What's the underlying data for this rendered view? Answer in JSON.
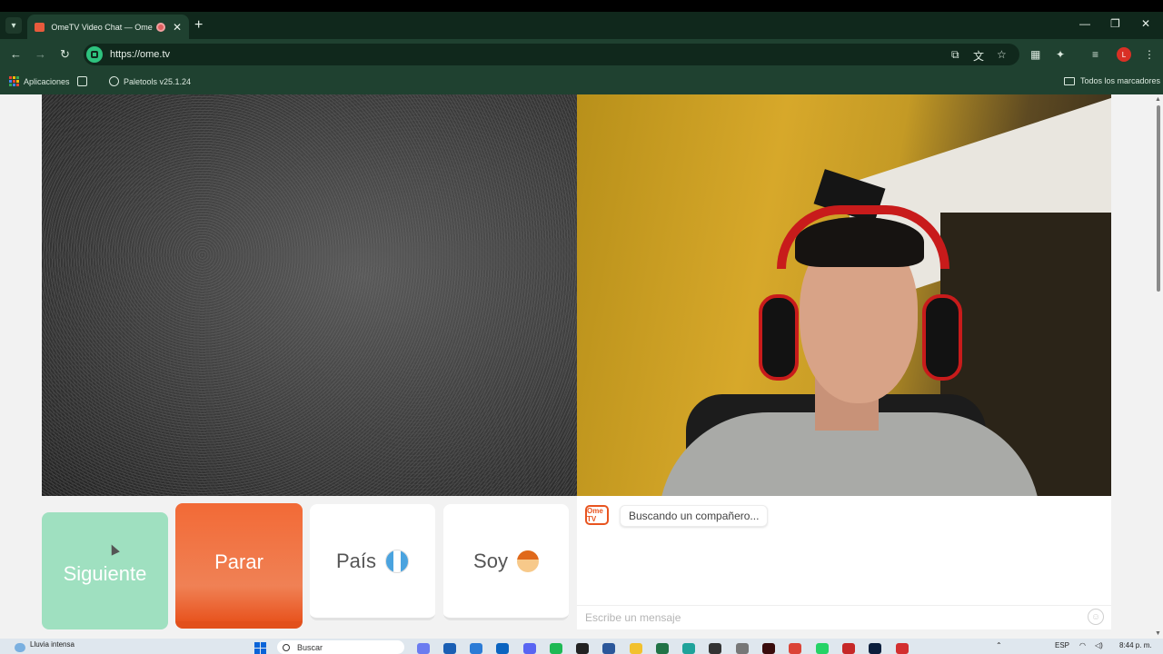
{
  "browser": {
    "tab_title": "OmeTV Video Chat — Omegle",
    "url": "https://ome.tv",
    "avatar_initial": "L",
    "bookmarks": [
      {
        "label": "Aplicaciones"
      },
      {
        "label": "Paletools v25.1.24"
      }
    ],
    "all_bookmarks_label": "Todos los marcadores"
  },
  "controls": {
    "next_label": "Siguiente",
    "stop_label": "Parar",
    "country_label": "País",
    "gender_label": "Soy"
  },
  "chat": {
    "logo_text": "Ome TV",
    "status_message": "Buscando un compañero...",
    "input_placeholder": "Escribe un mensaje"
  },
  "taskbar": {
    "weather": "Lluvia intensa",
    "search_placeholder": "Buscar",
    "language": "ESP",
    "time": "8:44 p. m."
  },
  "colors": {
    "accent_orange": "#f26a36",
    "next_green": "#9fe0c0",
    "browser_chrome": "#1f4130"
  }
}
